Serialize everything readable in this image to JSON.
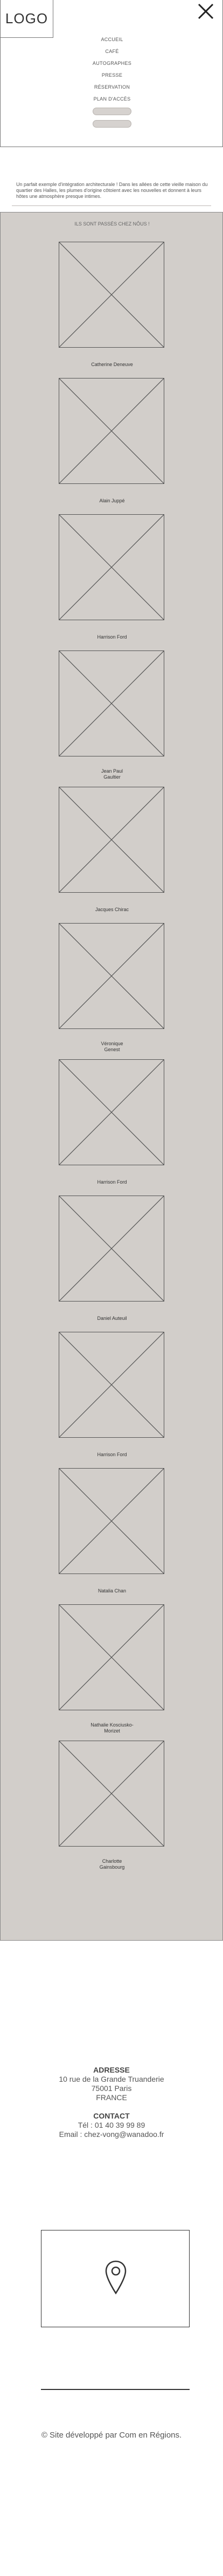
{
  "header": {
    "logo": "LOGO",
    "nav": [
      "ACCUEIL",
      "CAFÉ",
      "AUTOGRAPHES",
      "PRESSE",
      "RÉSERVATION",
      "PLAN D'ACCÈS"
    ],
    "pills": [
      "",
      ""
    ]
  },
  "intro": {
    "text": "Un parfait exemple d'intégration architecturale ! Dans les allées de cette vieille maison du quartier des Halles, les plumes d'origine côtoient avec les nouvelles et donnent à leurs hôtes une atmosphère presque intimes."
  },
  "gallery": {
    "title": "ILS SONT PASSÉS CHEZ NÔUS !",
    "artists": [
      [
        "Catherine Deneuve"
      ],
      [
        "Alain Juppé"
      ],
      [
        "Harrison Ford"
      ],
      [
        "Jean Paul",
        "Gaultier"
      ],
      [
        "Jacques Chirac"
      ],
      [
        "Véronique",
        "Genest"
      ],
      [
        "Harrison Ford"
      ],
      [
        "Daniel Auteuil"
      ],
      [
        "Harrison Ford"
      ],
      [
        "Natalia Chan"
      ],
      [
        "Nathalie Kosciusko-",
        "Morizet"
      ],
      [
        "Charlotte",
        "Gainsbourg"
      ]
    ]
  },
  "contact": {
    "address_heading": "ADRESSE",
    "address_lines": [
      "10 rue de la Grande Truanderie",
      "75001 Paris",
      "FRANCE"
    ],
    "contact_heading": "CONTACT",
    "phone": "Tél : 01 40 39 99 89",
    "email": "Email : chez-vong@wanadoo.fr"
  },
  "map": {
    "icon": "location-pin-icon"
  },
  "footer": {
    "text": "© Site développé par Com en Régions."
  },
  "colors": {
    "gallery_bg": "#d2ceca",
    "border": "#555555"
  }
}
